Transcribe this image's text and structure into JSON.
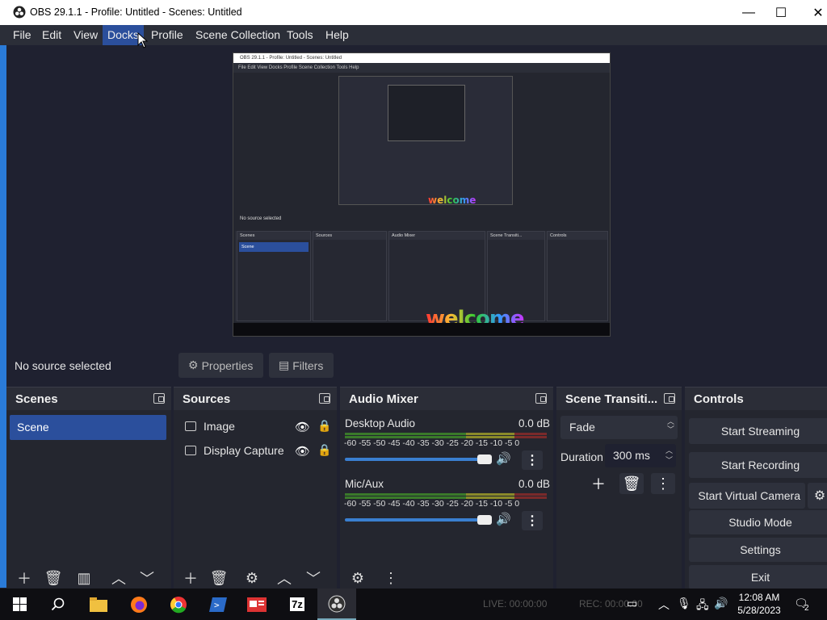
{
  "window": {
    "title": "OBS 29.1.1 - Profile: Untitled - Scenes: Untitled",
    "minimize_glyph": "—",
    "maximize_glyph": "☐",
    "close_glyph": "✕"
  },
  "menu": [
    "File",
    "Edit",
    "View",
    "Docks",
    "Profile",
    "Scene Collection",
    "Tools",
    "Help"
  ],
  "menu_active": "Docks",
  "preview": {
    "nested_title": "OBS 29.1.1 - Profile: Untitled - Scenes: Untitled",
    "nested_menu": "File   Edit   View   Docks   Profile   Scene Collection   Tools   Help",
    "nested_no_source": "No source selected",
    "nested_docks": [
      "Scenes",
      "Sources",
      "Audio Mixer",
      "Scene Transiti...",
      "Controls"
    ],
    "nested_scene": "Scene",
    "welcome": "welcome"
  },
  "context": {
    "no_source": "No source selected",
    "properties": "Properties",
    "filters": "Filters"
  },
  "scenes": {
    "title": "Scenes",
    "items": [
      "Scene"
    ]
  },
  "sources": {
    "title": "Sources",
    "items": [
      {
        "label": "Image",
        "icon": "image-icon"
      },
      {
        "label": "Display Capture",
        "icon": "monitor-icon"
      }
    ]
  },
  "mixer": {
    "title": "Audio Mixer",
    "channels": [
      {
        "name": "Desktop Audio",
        "db": "0.0 dB",
        "scale": "-60 -55 -50 -45 -40 -35 -30 -25 -20 -15 -10  -5   0",
        "volume": 1.0
      },
      {
        "name": "Mic/Aux",
        "db": "0.0 dB",
        "scale": "-60 -55 -50 -45 -40 -35 -30 -25 -20 -15 -10  -5   0",
        "volume": 1.0
      }
    ]
  },
  "transitions": {
    "title": "Scene Transiti...",
    "selected": "Fade",
    "duration_label": "Duration",
    "duration_value": "300 ms"
  },
  "controls": {
    "title": "Controls",
    "buttons": [
      "Start Streaming",
      "Start Recording",
      "Start Virtual Camera",
      "Studio Mode",
      "Settings",
      "Exit"
    ]
  },
  "taskbar": {
    "live": "LIVE: 00:00:00",
    "rec": "REC: 00:00:00",
    "time": "12:08 AM",
    "date": "5/28/2023",
    "notifications": "2",
    "apps": [
      "start-icon",
      "search-icon",
      "file-explorer-icon",
      "firefox-icon",
      "chrome-icon",
      "powershell-icon",
      "presentation-icon",
      "7zip-icon",
      "obs-icon"
    ],
    "seven_zip_label": "7z"
  },
  "colors": {
    "accent": "#2b4f9c",
    "panel": "#24262f",
    "background": "#1f2130"
  }
}
